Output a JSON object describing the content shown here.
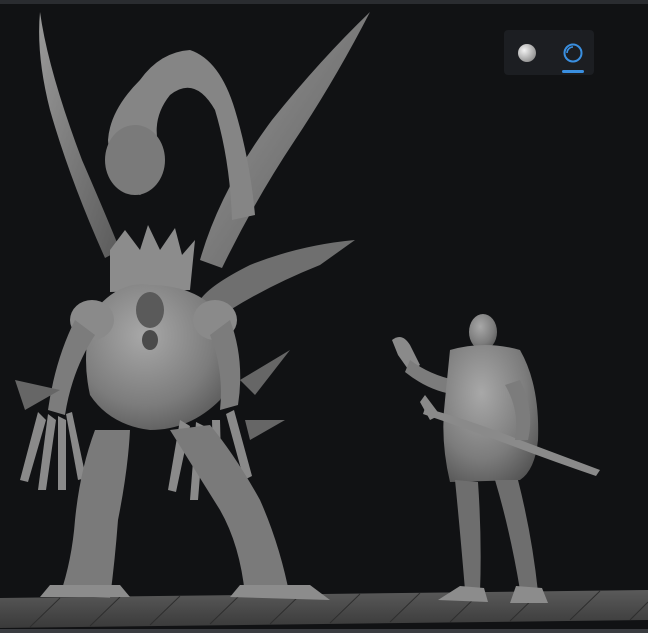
{
  "viewer": {
    "title": "",
    "models": [
      {
        "name": "winged-demon-miniature"
      },
      {
        "name": "ranger-with-staff-miniature"
      }
    ]
  },
  "toolbar": {
    "buttons": [
      {
        "name": "shaded-view",
        "icon": "solid-sphere-icon",
        "active": false
      },
      {
        "name": "matcap-view",
        "icon": "outlined-sphere-icon",
        "active": true
      }
    ]
  },
  "colors": {
    "background": "#111214",
    "model": "#8a8a8a",
    "accent": "#3a8fe0",
    "toolbar_bg": "#1c1e22"
  }
}
